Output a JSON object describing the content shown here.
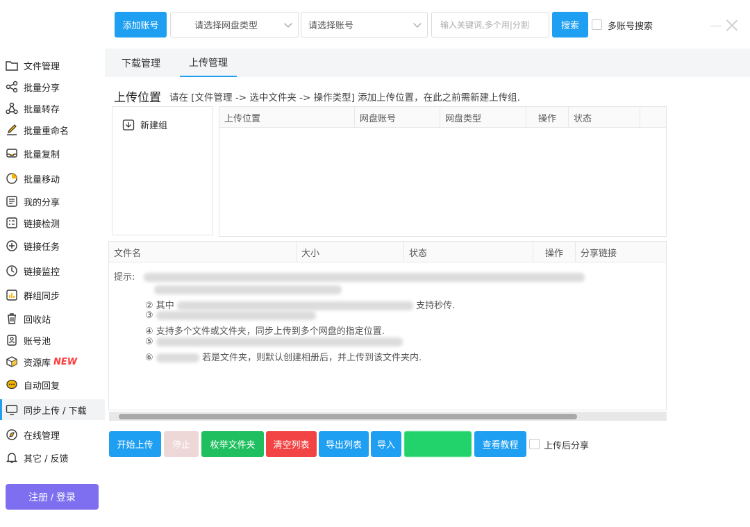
{
  "toolbar": {
    "add_account": "添加账号",
    "disk_type_placeholder": "请选择网盘类型",
    "account_placeholder": "请选择账号",
    "keyword_placeholder": "输入关键词,多个用|分割",
    "search": "搜索",
    "multi_search": "多账号搜索"
  },
  "sidebar": {
    "items": [
      {
        "label": "文件管理",
        "icon": "folder-icon"
      },
      {
        "label": "批量分享",
        "icon": "share-icon"
      },
      {
        "label": "批量转存",
        "icon": "transfer-icon"
      },
      {
        "label": "批量重命名",
        "icon": "rename-icon"
      },
      {
        "label": "批量复制",
        "icon": "copy-icon"
      },
      {
        "label": "批量移动",
        "icon": "move-icon"
      },
      {
        "label": "我的分享",
        "icon": "my-share-icon"
      },
      {
        "label": "链接检测",
        "icon": "link-check-icon"
      },
      {
        "label": "链接任务",
        "icon": "link-task-icon"
      },
      {
        "label": "链接监控",
        "icon": "link-monitor-icon"
      },
      {
        "label": "群组同步",
        "icon": "group-sync-icon"
      },
      {
        "label": "回收站",
        "icon": "trash-icon"
      },
      {
        "label": "账号池",
        "icon": "account-pool-icon"
      },
      {
        "label": "资源库",
        "icon": "resource-icon",
        "badge": "NEW"
      },
      {
        "label": "自动回复",
        "icon": "auto-reply-icon"
      },
      {
        "label": "同步上传 / 下载",
        "icon": "sync-upload-icon"
      },
      {
        "label": "在线管理",
        "icon": "online-manage-icon"
      },
      {
        "label": "其它 / 反馈",
        "icon": "bell-icon"
      }
    ],
    "login": "注册 / 登录"
  },
  "tabs": [
    {
      "label": "下载管理"
    },
    {
      "label": "上传管理"
    }
  ],
  "upload": {
    "title": "上传位置",
    "description": "请在 [文件管理 -> 选中文件夹 -> 操作类型] 添加上传位置，在此之前需新建上传组.",
    "new_group": "新建组",
    "location_columns": [
      "上传位置",
      "网盘账号",
      "网盘类型",
      "操作",
      "状态"
    ],
    "file_columns": [
      "文件名",
      "大小",
      "状态",
      "操作",
      "分享链接"
    ]
  },
  "hints": {
    "label": "提示:",
    "line2_prefix": "② 其中",
    "line2_suffix": "支持秒传.",
    "line3": "③",
    "line4": "④ 支持多个文件或文件夹，同步上传到多个网盘的指定位置.",
    "line5": "⑤",
    "line6_prefix": "⑥",
    "line6_suffix": "若是文件夹，则默认创建相册后，并上传到该文件夹内."
  },
  "actions": {
    "start": "开始上传",
    "stop": "停止",
    "enum_folder": "枚举文件夹",
    "clear": "清空列表",
    "export": "导出列表",
    "import": "导入",
    "tutorial": "查看教程",
    "share_after": "上传后分享"
  },
  "colors": {
    "primary": "#1e9ff2",
    "success": "#1fbf5f",
    "danger": "#f24444",
    "login": "#7e6ff0",
    "new_badge": "#ff3b3b"
  }
}
